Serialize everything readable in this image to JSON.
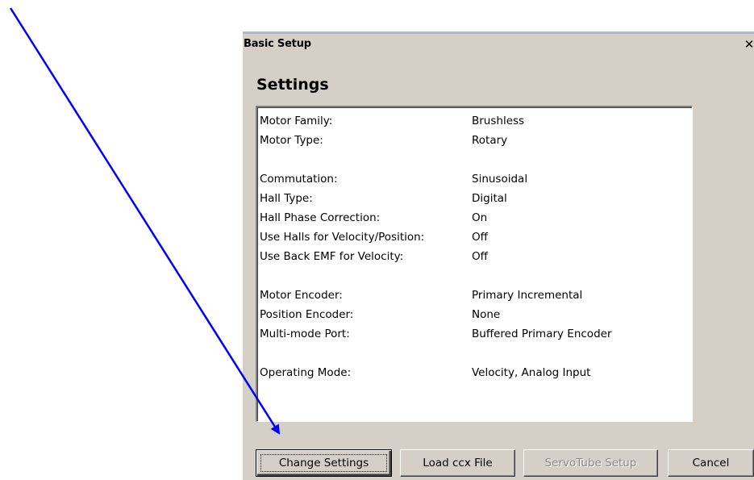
{
  "window": {
    "title": "Basic Setup",
    "close_glyph": "✕",
    "close_label": "X"
  },
  "main": {
    "heading": "Settings",
    "settings": [
      {
        "label": "Motor Family:",
        "value": "Brushless",
        "gap_before": false
      },
      {
        "label": "Motor Type:",
        "value": "Rotary",
        "gap_before": false
      },
      {
        "label": "Commutation:",
        "value": "Sinusoidal",
        "gap_before": true
      },
      {
        "label": "Hall Type:",
        "value": "Digital",
        "gap_before": false
      },
      {
        "label": "Hall Phase Correction:",
        "value": "On",
        "gap_before": false
      },
      {
        "label": "Use Halls for Velocity/Position:",
        "value": "Off",
        "gap_before": false
      },
      {
        "label": "Use Back EMF for Velocity:",
        "value": "Off",
        "gap_before": false
      },
      {
        "label": "Motor Encoder:",
        "value": "Primary Incremental",
        "gap_before": true
      },
      {
        "label": "Position Encoder:",
        "value": "None",
        "gap_before": false
      },
      {
        "label": "Multi-mode Port:",
        "value": "Buffered Primary Encoder",
        "gap_before": false
      },
      {
        "label": "Operating Mode:",
        "value": "Velocity, Analog Input",
        "gap_before": true
      }
    ]
  },
  "buttons": {
    "change_settings": "Change Settings",
    "load_ccx": "Load ccx File",
    "servotube_setup": "ServoTube Setup",
    "cancel": "Cancel"
  },
  "annotation": {
    "arrow_color": "#0000ff",
    "icon": "arrow-icon"
  },
  "colors": {
    "dialog_bg": "#d4d0c8",
    "disabled_text": "#8e8a82"
  }
}
